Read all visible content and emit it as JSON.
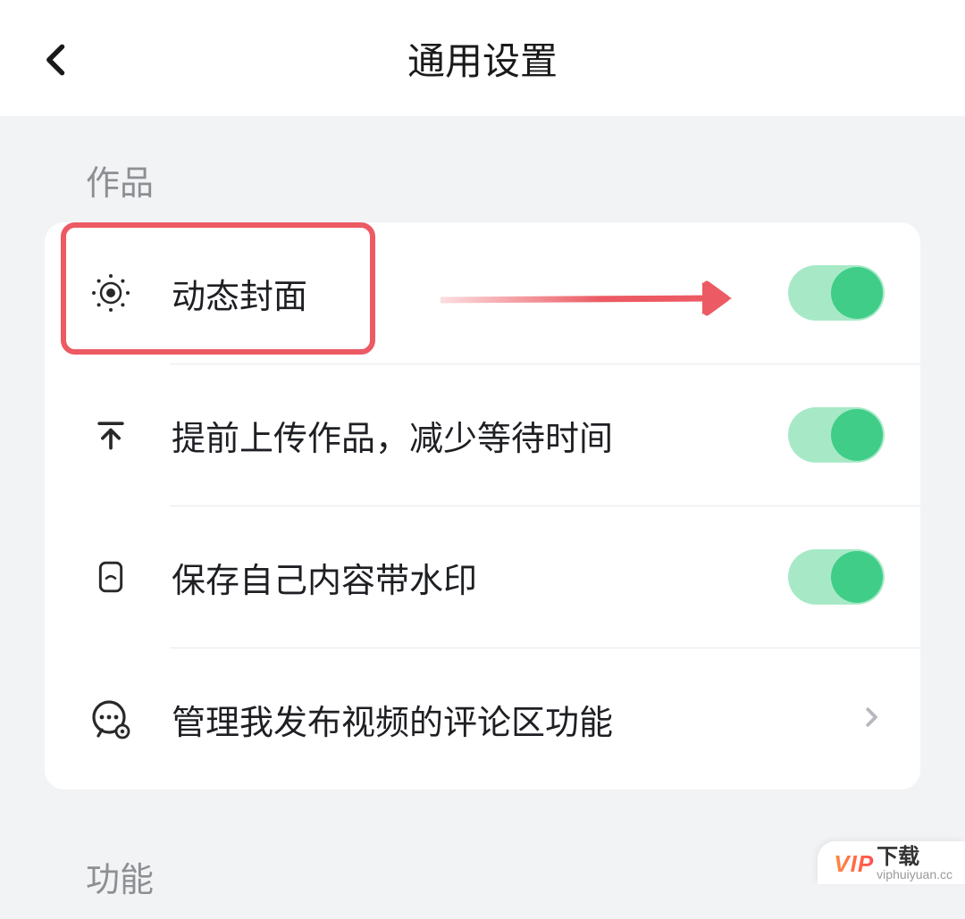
{
  "header": {
    "title": "通用设置"
  },
  "sections": {
    "works": {
      "label": "作品",
      "items": {
        "dynamicCover": {
          "label": "动态封面",
          "toggle": true
        },
        "preUpload": {
          "label": "提前上传作品，减少等待时间",
          "toggle": true
        },
        "saveWatermark": {
          "label": "保存自己内容带水印",
          "toggle": true
        },
        "manageComments": {
          "label": "管理我发布视频的评论区功能"
        }
      }
    },
    "features": {
      "label": "功能"
    }
  },
  "watermark": {
    "vip": "VIP",
    "text": "下载",
    "url": "viphuiyuan.cc"
  },
  "colors": {
    "toggleOnTrack": "#a7e9c6",
    "toggleOnKnob": "#3fcd88",
    "highlight": "#ec5a63"
  }
}
